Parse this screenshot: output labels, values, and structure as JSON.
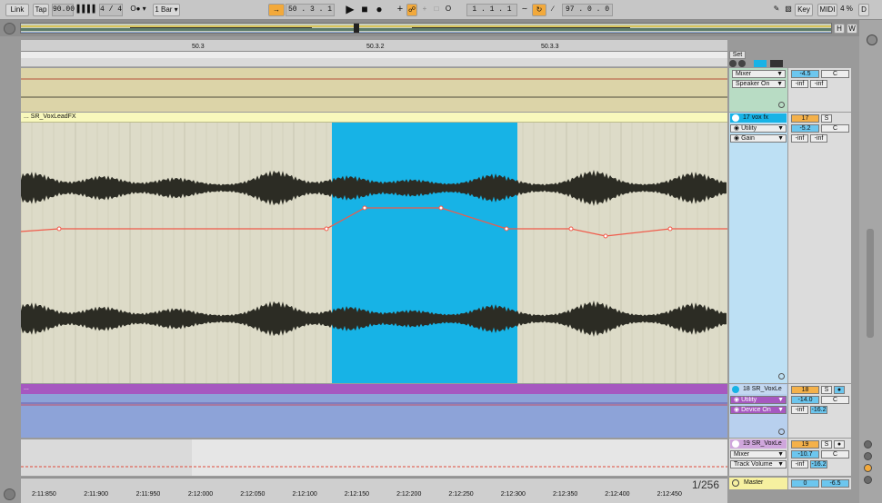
{
  "transport": {
    "link": "Link",
    "tap": "Tap",
    "tempo": "90.00",
    "time_sig": "4 / 4",
    "quantize": "1 Bar ▾",
    "position": "50 .  3 .  1",
    "loop_start": "1 .  1 .  1",
    "loop_length": "97 .  0 .  0",
    "key": "Key",
    "midi": "MIDI",
    "cpu": "4 %",
    "disk": "D"
  },
  "overview": {
    "h": "H",
    "w": "W"
  },
  "ruler": {
    "ticks": [
      "50.3",
      "50.3.2",
      "50.3.3"
    ]
  },
  "bottom_ruler": {
    "ticks": [
      "2:11:850",
      "2:11:900",
      "2:11:950",
      "2:12:000",
      "2:12:050",
      "2:12:100",
      "2:12:150",
      "2:12:200",
      "2:12:250",
      "2:12:300",
      "2:12:350",
      "2:12:400",
      "2:12:450"
    ],
    "zoom": "1/256"
  },
  "set_label": "Set",
  "tracks": {
    "t1": {
      "device": "Mixer",
      "param": "Speaker On",
      "vol": "-4.5",
      "pan": "C",
      "peak_l": "-inf",
      "peak_r": "-inf"
    },
    "t2": {
      "clip_name": "... SR_VoxLeadFX",
      "name": "17 vox fx",
      "device": "Utility",
      "param": "Gain",
      "num": "17",
      "solo": "S",
      "vol": "-5.2",
      "pan": "C",
      "peak_l": "-inf",
      "peak_r": "-inf"
    },
    "t3": {
      "clip_name": "...",
      "name": "18 SR_VoxLe",
      "device": "Utility",
      "param": "Device On",
      "num": "18",
      "solo": "S",
      "vol": "-14.0",
      "pan": "C",
      "peak_l": "-inf",
      "peak_r": "-16.2"
    },
    "t4": {
      "name": "19 SR_VoxLe",
      "device": "Mixer",
      "param": "Track Volume",
      "num": "19",
      "solo": "S",
      "vol": "-10.7",
      "pan": "C",
      "peak_l": "-inf",
      "peak_r": "-16.2"
    },
    "master": {
      "name": "Master",
      "num": "0",
      "vol": "-6.5"
    }
  },
  "colors": {
    "selection": "#17b3e6",
    "automation": "#f05a4a",
    "track17": "#f8f8bc",
    "track18": "#a658c0",
    "accent_orange": "#f2a93b"
  }
}
